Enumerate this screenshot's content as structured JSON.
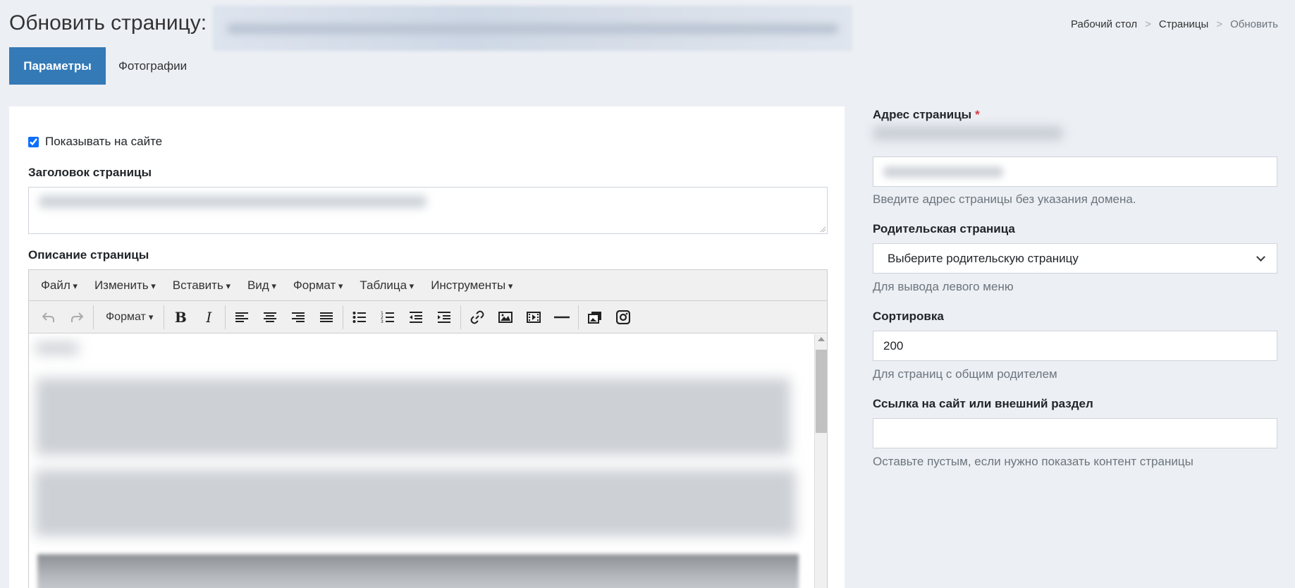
{
  "header": {
    "title": "Обновить страницу:",
    "breadcrumb": [
      {
        "label": "Рабочий стол"
      },
      {
        "label": "Страницы"
      },
      {
        "label": "Обновить"
      }
    ]
  },
  "tabs": [
    {
      "label": "Параметры"
    },
    {
      "label": "Фотографии"
    }
  ],
  "form": {
    "show_on_site_label": "Показывать на сайте",
    "page_title_label": "Заголовок страницы",
    "description_label": "Описание страницы"
  },
  "editor": {
    "menus": [
      "Файл",
      "Изменить",
      "Вставить",
      "Вид",
      "Формат",
      "Таблица",
      "Инструменты"
    ],
    "format_select": "Формат",
    "bold_glyph": "B",
    "italic_glyph": "I"
  },
  "sidebar": {
    "address_label": "Адрес страницы",
    "required_mark": "*",
    "address_help": "Введите адрес страницы без указания домена.",
    "parent_label": "Родительская страница",
    "parent_value": "Выберите родительскую страницу",
    "parent_help": "Для вывода левого меню",
    "sort_label": "Сортировка",
    "sort_value": "200",
    "sort_help": "Для страниц с общим родителем",
    "link_label": "Ссылка на сайт или внешний раздел",
    "link_value": "",
    "link_help": "Оставьте пустым, если нужно показать контент страницы"
  },
  "colors": {
    "accent": "#337ab7",
    "background": "#eceff4",
    "required": "#dc3545"
  }
}
